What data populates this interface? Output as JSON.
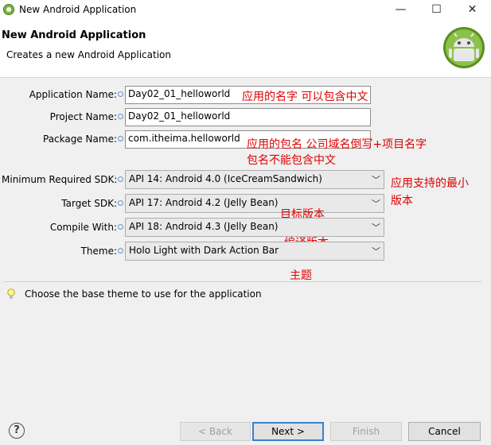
{
  "window": {
    "title": "New Android Application",
    "controls": {
      "minimize": "—",
      "maximize": "☐",
      "close": "✕"
    }
  },
  "header": {
    "title": "New Android Application",
    "subtitle": "Creates a new Android Application"
  },
  "form": {
    "application_name": {
      "label": "Application Name:",
      "value": "Day02_01_helloworld"
    },
    "project_name": {
      "label": "Project Name:",
      "value": "Day02_01_helloworld"
    },
    "package_name": {
      "label": "Package Name:",
      "value": "com.itheima.helloworld"
    },
    "min_sdk": {
      "label": "Minimum Required SDK:",
      "value": "API 14: Android 4.0 (IceCreamSandwich)"
    },
    "target_sdk": {
      "label": "Target SDK:",
      "value": "API 17: Android 4.2 (Jelly Bean)"
    },
    "compile_with": {
      "label": "Compile With:",
      "value": "API 18: Android 4.3 (Jelly Bean)"
    },
    "theme": {
      "label": "Theme:",
      "value": "Holo Light with Dark Action Bar"
    }
  },
  "annotations": {
    "app_name_note": "应用的名字 可以包含中文",
    "package_note_1": "应用的包名 公司域名倒写+项目名字",
    "package_note_2": "包名不能包含中文",
    "min_sdk_note_1": "应用支持的最小",
    "min_sdk_note_2": "版本",
    "target_note": "目标版本",
    "compile_note": "编译版本",
    "theme_note": "主题"
  },
  "hint": "Choose the base theme to use for the application",
  "buttons": {
    "back": "< Back",
    "next": "Next >",
    "finish": "Finish",
    "cancel": "Cancel",
    "help": "?"
  },
  "colors": {
    "annotation": "#e00000",
    "android_green": "#8bc34a",
    "focus_border": "#3c7fd1"
  }
}
